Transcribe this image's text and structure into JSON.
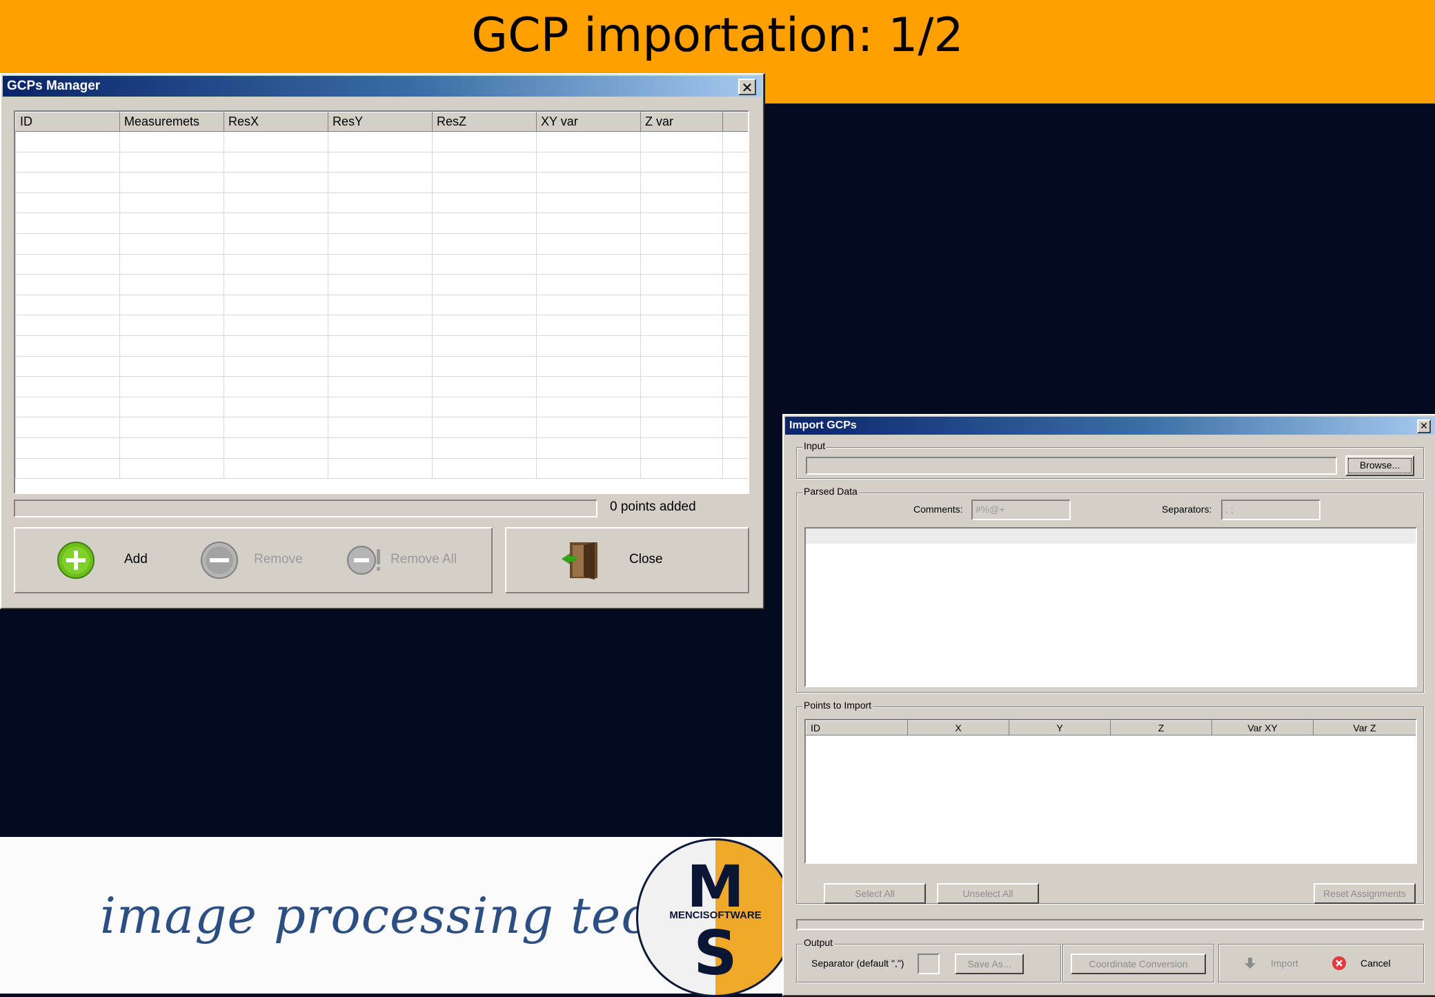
{
  "slide": {
    "title": "GCP importation: 1/2",
    "tagline": "image processing tech",
    "logo": {
      "text": "MENCISOFTWARE",
      "letters": [
        "M",
        "S"
      ]
    }
  },
  "gcp_manager": {
    "title": "GCPs Manager",
    "columns": [
      "ID",
      "Measuremets",
      "ResX",
      "ResY",
      "ResZ",
      "XY var",
      "Z var"
    ],
    "status": "0 points added",
    "buttons": {
      "add": "Add",
      "remove": "Remove",
      "remove_all": "Remove All",
      "close": "Close"
    },
    "colors": {
      "add": "#6cbf1a",
      "disabled": "#9a9a9a"
    }
  },
  "import_gcps": {
    "title": "Import GCPs",
    "input_group": "Input",
    "browse": "Browse...",
    "parsed_group": "Parsed Data",
    "comments_label": "Comments:",
    "comments_value": "#%@+",
    "separators_label": "Separators:",
    "separators_value": ", ;",
    "points_group": "Points to Import",
    "points_columns": [
      "ID",
      "X",
      "Y",
      "Z",
      "Var XY",
      "Var Z"
    ],
    "select_all": "Select All",
    "unselect_all": "Unselect All",
    "reset_assignments": "Reset Assignments",
    "output_group": "Output",
    "separator_label": "Separator (default \",\")",
    "save_as": "Save As...",
    "coordinate_conversion": "Coordinate Conversion",
    "import": "Import",
    "cancel": "Cancel"
  }
}
